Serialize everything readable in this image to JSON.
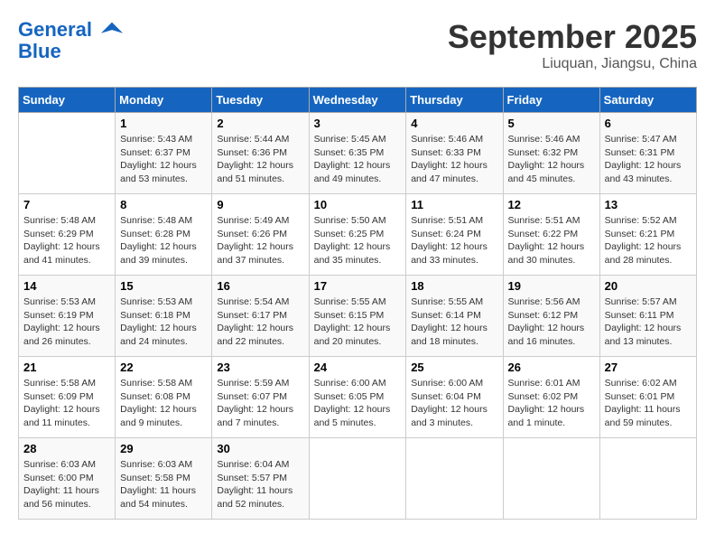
{
  "header": {
    "logo_line1": "General",
    "logo_line2": "Blue",
    "month": "September 2025",
    "location": "Liuquan, Jiangsu, China"
  },
  "columns": [
    "Sunday",
    "Monday",
    "Tuesday",
    "Wednesday",
    "Thursday",
    "Friday",
    "Saturday"
  ],
  "weeks": [
    [
      {
        "num": "",
        "info": ""
      },
      {
        "num": "1",
        "info": "Sunrise: 5:43 AM\nSunset: 6:37 PM\nDaylight: 12 hours\nand 53 minutes."
      },
      {
        "num": "2",
        "info": "Sunrise: 5:44 AM\nSunset: 6:36 PM\nDaylight: 12 hours\nand 51 minutes."
      },
      {
        "num": "3",
        "info": "Sunrise: 5:45 AM\nSunset: 6:35 PM\nDaylight: 12 hours\nand 49 minutes."
      },
      {
        "num": "4",
        "info": "Sunrise: 5:46 AM\nSunset: 6:33 PM\nDaylight: 12 hours\nand 47 minutes."
      },
      {
        "num": "5",
        "info": "Sunrise: 5:46 AM\nSunset: 6:32 PM\nDaylight: 12 hours\nand 45 minutes."
      },
      {
        "num": "6",
        "info": "Sunrise: 5:47 AM\nSunset: 6:31 PM\nDaylight: 12 hours\nand 43 minutes."
      }
    ],
    [
      {
        "num": "7",
        "info": "Sunrise: 5:48 AM\nSunset: 6:29 PM\nDaylight: 12 hours\nand 41 minutes."
      },
      {
        "num": "8",
        "info": "Sunrise: 5:48 AM\nSunset: 6:28 PM\nDaylight: 12 hours\nand 39 minutes."
      },
      {
        "num": "9",
        "info": "Sunrise: 5:49 AM\nSunset: 6:26 PM\nDaylight: 12 hours\nand 37 minutes."
      },
      {
        "num": "10",
        "info": "Sunrise: 5:50 AM\nSunset: 6:25 PM\nDaylight: 12 hours\nand 35 minutes."
      },
      {
        "num": "11",
        "info": "Sunrise: 5:51 AM\nSunset: 6:24 PM\nDaylight: 12 hours\nand 33 minutes."
      },
      {
        "num": "12",
        "info": "Sunrise: 5:51 AM\nSunset: 6:22 PM\nDaylight: 12 hours\nand 30 minutes."
      },
      {
        "num": "13",
        "info": "Sunrise: 5:52 AM\nSunset: 6:21 PM\nDaylight: 12 hours\nand 28 minutes."
      }
    ],
    [
      {
        "num": "14",
        "info": "Sunrise: 5:53 AM\nSunset: 6:19 PM\nDaylight: 12 hours\nand 26 minutes."
      },
      {
        "num": "15",
        "info": "Sunrise: 5:53 AM\nSunset: 6:18 PM\nDaylight: 12 hours\nand 24 minutes."
      },
      {
        "num": "16",
        "info": "Sunrise: 5:54 AM\nSunset: 6:17 PM\nDaylight: 12 hours\nand 22 minutes."
      },
      {
        "num": "17",
        "info": "Sunrise: 5:55 AM\nSunset: 6:15 PM\nDaylight: 12 hours\nand 20 minutes."
      },
      {
        "num": "18",
        "info": "Sunrise: 5:55 AM\nSunset: 6:14 PM\nDaylight: 12 hours\nand 18 minutes."
      },
      {
        "num": "19",
        "info": "Sunrise: 5:56 AM\nSunset: 6:12 PM\nDaylight: 12 hours\nand 16 minutes."
      },
      {
        "num": "20",
        "info": "Sunrise: 5:57 AM\nSunset: 6:11 PM\nDaylight: 12 hours\nand 13 minutes."
      }
    ],
    [
      {
        "num": "21",
        "info": "Sunrise: 5:58 AM\nSunset: 6:09 PM\nDaylight: 12 hours\nand 11 minutes."
      },
      {
        "num": "22",
        "info": "Sunrise: 5:58 AM\nSunset: 6:08 PM\nDaylight: 12 hours\nand 9 minutes."
      },
      {
        "num": "23",
        "info": "Sunrise: 5:59 AM\nSunset: 6:07 PM\nDaylight: 12 hours\nand 7 minutes."
      },
      {
        "num": "24",
        "info": "Sunrise: 6:00 AM\nSunset: 6:05 PM\nDaylight: 12 hours\nand 5 minutes."
      },
      {
        "num": "25",
        "info": "Sunrise: 6:00 AM\nSunset: 6:04 PM\nDaylight: 12 hours\nand 3 minutes."
      },
      {
        "num": "26",
        "info": "Sunrise: 6:01 AM\nSunset: 6:02 PM\nDaylight: 12 hours\nand 1 minute."
      },
      {
        "num": "27",
        "info": "Sunrise: 6:02 AM\nSunset: 6:01 PM\nDaylight: 11 hours\nand 59 minutes."
      }
    ],
    [
      {
        "num": "28",
        "info": "Sunrise: 6:03 AM\nSunset: 6:00 PM\nDaylight: 11 hours\nand 56 minutes."
      },
      {
        "num": "29",
        "info": "Sunrise: 6:03 AM\nSunset: 5:58 PM\nDaylight: 11 hours\nand 54 minutes."
      },
      {
        "num": "30",
        "info": "Sunrise: 6:04 AM\nSunset: 5:57 PM\nDaylight: 11 hours\nand 52 minutes."
      },
      {
        "num": "",
        "info": ""
      },
      {
        "num": "",
        "info": ""
      },
      {
        "num": "",
        "info": ""
      },
      {
        "num": "",
        "info": ""
      }
    ]
  ]
}
